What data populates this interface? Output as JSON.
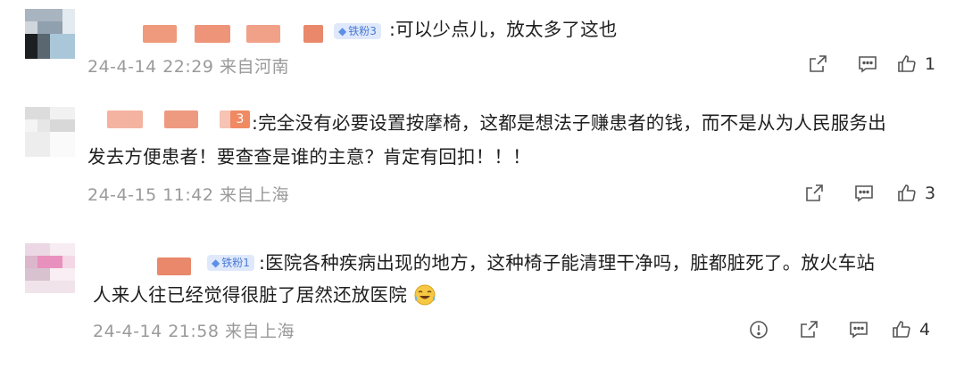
{
  "comments": [
    {
      "badge": "铁粉3",
      "text_lines": [
        ":可以少点儿，放太多了这也"
      ],
      "meta": "24-4-14 22:29 来自河南",
      "likes": "1",
      "icons": [
        "share-icon",
        "comment-icon",
        "like-icon"
      ]
    },
    {
      "badge": "",
      "badge_fragment": "3",
      "text_lines": [
        ":完全没有必要设置按摩椅，这都是想法子赚患者的钱，而不是从为人民服务出",
        "发去方便患者！要查查是谁的主意？肯定有回扣！！！"
      ],
      "meta": "24-4-15 11:42 来自上海",
      "likes": "3",
      "icons": [
        "share-icon",
        "comment-icon",
        "like-icon"
      ]
    },
    {
      "badge": "铁粉1",
      "text_lines": [
        ":医院各种疾病出现的地方，这种椅子能清理干净吗，脏都脏死了。放火车站",
        "人来人往已经觉得很脏了居然还放医院"
      ],
      "emoji": "laugh-cry-emoji",
      "meta": "24-4-14 21:58 来自上海",
      "likes": "4",
      "icons": [
        "report-icon",
        "share-icon",
        "comment-icon",
        "like-icon"
      ]
    }
  ],
  "colors": {
    "text": "#1f1f1f",
    "meta": "#9a9a9a",
    "badge_bg": "#dfe9fb",
    "badge_fg": "#4a79d6",
    "blur_orange": "#e9886a"
  }
}
